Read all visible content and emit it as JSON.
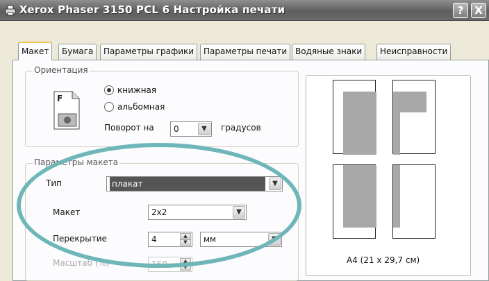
{
  "window": {
    "title": "Xerox Phaser 3150 PCL 6 Настройка печати",
    "help_label": "?",
    "close_label": "X"
  },
  "tabs": [
    "Макет",
    "Бумага",
    "Параметры графики",
    "Параметры печати",
    "Водяные знаки",
    "Неисправности"
  ],
  "orientation": {
    "legend": "Ориентация",
    "portrait_label": "книжная",
    "landscape_label": "альбомная",
    "selected": "книжная",
    "rotate_label": "Поворот на",
    "rotate_value": "0",
    "degrees_label": "градусов"
  },
  "layout": {
    "legend": "Параметры макета",
    "type_label": "Тип",
    "type_value": "плакат",
    "layout_label": "Макет",
    "layout_value": "2x2",
    "overlap_label": "Перекрытие",
    "overlap_value": "4",
    "unit_value": "мм",
    "scale_label": "Масштаб (%)",
    "scale_value": "150"
  },
  "preview": {
    "caption": "A4 (21 x 29,7 см)"
  },
  "colors": {
    "annotation_ellipse": "#6fb6b9",
    "selected_highlight": "#555555"
  }
}
